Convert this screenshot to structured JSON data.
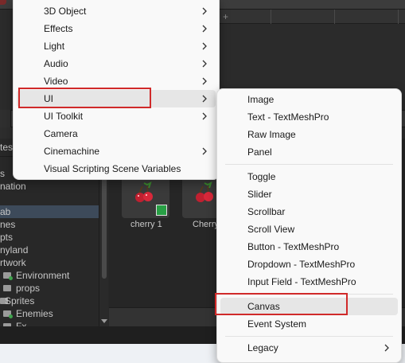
{
  "context_menu": {
    "items": [
      {
        "label": "3D Object",
        "submenu": true
      },
      {
        "label": "Effects",
        "submenu": true
      },
      {
        "label": "Light",
        "submenu": true
      },
      {
        "label": "Audio",
        "submenu": true
      },
      {
        "label": "Video",
        "submenu": true
      },
      {
        "label": "UI",
        "submenu": true
      },
      {
        "label": "UI Toolkit",
        "submenu": true
      },
      {
        "label": "Camera",
        "submenu": false
      },
      {
        "label": "Cinemachine",
        "submenu": true
      },
      {
        "label": "Visual Scripting Scene Variables",
        "submenu": false
      }
    ]
  },
  "ui_submenu": {
    "group1": [
      "Image",
      "Text - TextMeshPro",
      "Raw Image",
      "Panel"
    ],
    "group2": [
      "Toggle",
      "Slider",
      "Scrollbar",
      "Scroll View",
      "Button - TextMeshPro",
      "Dropdown - TextMeshPro",
      "Input Field - TextMeshPro"
    ],
    "group3": [
      "Canvas",
      "Event System"
    ],
    "group4": [
      "Legacy"
    ]
  },
  "project": {
    "breadcrumb": "tes",
    "tree": [
      "s",
      "nation",
      "",
      "ab",
      "nes",
      "pts",
      "nyland",
      "rtwork",
      "Environment",
      "props",
      "Sprites",
      "Enemies",
      "Fx"
    ],
    "assets": [
      "cherry 1",
      "Cherry"
    ]
  },
  "colors": {
    "menu_bg": "#f9f9f9",
    "highlight": "#e6e6e6",
    "annotation_red": "#d02a2a",
    "editor_dark": "#282828"
  }
}
